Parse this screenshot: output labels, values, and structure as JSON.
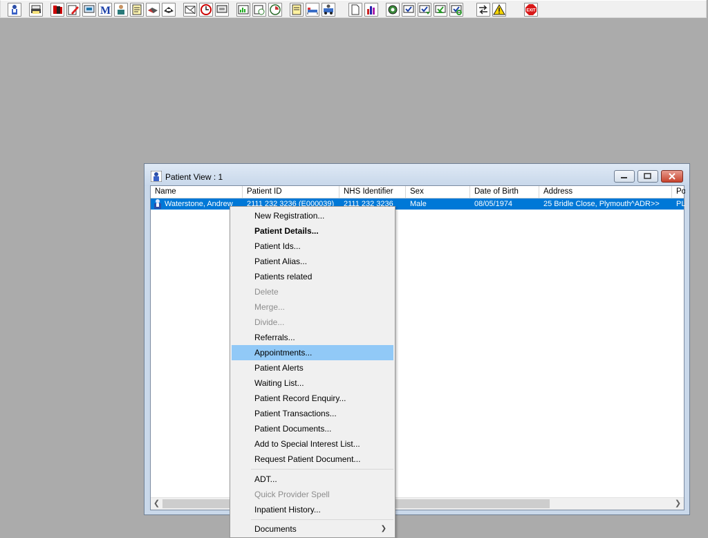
{
  "toolbar": {
    "buttons": [
      {
        "name": "patient-search-icon"
      },
      {
        "name": "print-icon"
      },
      {
        "name": "books-icon"
      },
      {
        "name": "edit-record-icon"
      },
      {
        "name": "network-icon"
      },
      {
        "name": "mail-m-icon"
      },
      {
        "name": "doctor-icon"
      },
      {
        "name": "notes-icon"
      },
      {
        "name": "handshake-icon"
      },
      {
        "name": "transfer-icon"
      },
      {
        "name": "envelope-icon"
      },
      {
        "name": "clock-icon"
      },
      {
        "name": "monitor-icon"
      },
      {
        "name": "chart-icon"
      },
      {
        "name": "document-clock-icon"
      },
      {
        "name": "timer-icon"
      },
      {
        "name": "memo-icon"
      },
      {
        "name": "bed-icon"
      },
      {
        "name": "ambulance-icon"
      },
      {
        "name": "blank-document-icon"
      },
      {
        "name": "bar-chart-icon"
      },
      {
        "name": "settings-globe-icon"
      },
      {
        "name": "checklist-icon"
      },
      {
        "name": "checklist-down-icon"
      },
      {
        "name": "checklist-green-icon"
      },
      {
        "name": "checklist-refresh-icon"
      },
      {
        "name": "swap-arrows-icon"
      },
      {
        "name": "warning-icon"
      },
      {
        "name": "exit-icon"
      }
    ],
    "exit_label": "EXIT"
  },
  "window": {
    "title": "Patient View : 1",
    "columns": [
      "Name",
      "Patient ID",
      "NHS Identifier",
      "Sex",
      "Date of Birth",
      "Address",
      "Po"
    ],
    "rows": [
      {
        "name": "Waterstone, Andrew",
        "patient_id": "2111 232 3236 (E000039)",
        "nhs_identifier": "2111 232 3236",
        "sex": "Male",
        "dob": "08/05/1974",
        "address": "25 Bridle Close, Plymouth^ADR>>",
        "postcode": "PL"
      }
    ]
  },
  "context_menu": {
    "items": [
      {
        "label": "New Registration..."
      },
      {
        "label": "Patient Details...",
        "bold": true
      },
      {
        "label": "Patient Ids..."
      },
      {
        "label": "Patient Alias..."
      },
      {
        "label": "Patients related"
      },
      {
        "label": "Delete",
        "disabled": true
      },
      {
        "label": "Merge...",
        "disabled": true
      },
      {
        "label": "Divide...",
        "disabled": true
      },
      {
        "label": "Referrals..."
      },
      {
        "label": "Appointments...",
        "highlighted": true
      },
      {
        "label": "Patient Alerts"
      },
      {
        "label": "Waiting List..."
      },
      {
        "label": "Patient Record Enquiry..."
      },
      {
        "label": "Patient Transactions..."
      },
      {
        "label": "Patient Documents..."
      },
      {
        "label": "Add to Special Interest List..."
      },
      {
        "label": "Request Patient Document..."
      },
      {
        "label": "ADT..."
      },
      {
        "label": "Quick Provider Spell",
        "disabled": true
      },
      {
        "label": "Inpatient History..."
      },
      {
        "label": "Documents",
        "submenu": true
      }
    ]
  },
  "colors": {
    "desktop": "#ababab",
    "selection": "#0078d7",
    "menu_highlight": "#91c9f7"
  }
}
